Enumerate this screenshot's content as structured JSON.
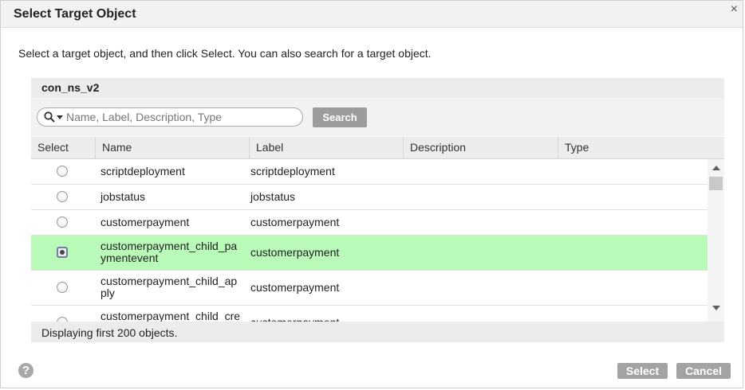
{
  "dialog": {
    "title": "Select Target Object",
    "close_glyph": "×",
    "instructions": "Select a target object, and then click Select. You can also search for a target object."
  },
  "connection": {
    "name": "con_ns_v2"
  },
  "search": {
    "placeholder": "Name, Label, Description, Type",
    "value": "",
    "button_label": "Search",
    "icon": "search-icon"
  },
  "table": {
    "columns": [
      "Select",
      "Name",
      "Label",
      "Description",
      "Type"
    ],
    "rows": [
      {
        "name": "scriptdeployment",
        "label": "scriptdeployment",
        "description": "",
        "type": "",
        "selected": false
      },
      {
        "name": "jobstatus",
        "label": "jobstatus",
        "description": "",
        "type": "",
        "selected": false
      },
      {
        "name": "customerpayment",
        "label": "customerpayment",
        "description": "",
        "type": "",
        "selected": false
      },
      {
        "name": "customerpayment_child_pa\nymentevent",
        "label": "customerpayment",
        "description": "",
        "type": "",
        "selected": true
      },
      {
        "name": "customerpayment_child_ap\nply",
        "label": "customerpayment",
        "description": "",
        "type": "",
        "selected": false
      },
      {
        "name": "customerpayment_child_cre",
        "label": "customerpayment",
        "description": "",
        "type": "",
        "selected": false
      }
    ],
    "selected_row_color": "#b9fab9"
  },
  "status": {
    "text": "Displaying first 200 objects."
  },
  "footer": {
    "help_glyph": "?",
    "select_label": "Select",
    "cancel_label": "Cancel"
  }
}
